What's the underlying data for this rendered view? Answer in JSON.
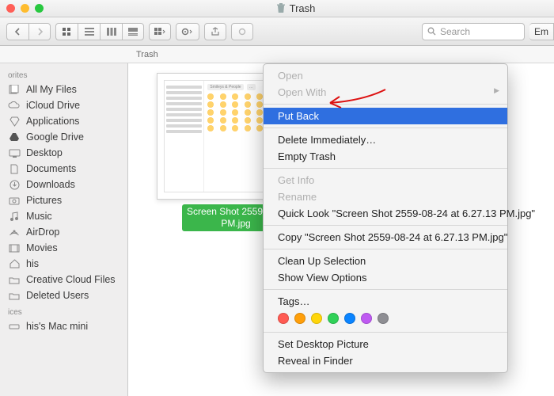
{
  "window": {
    "title": "Trash"
  },
  "toolbar": {
    "search_placeholder": "Search",
    "empty_label": "Em"
  },
  "location": {
    "label": "Trash"
  },
  "sidebar": {
    "sections": [
      {
        "head": "orites",
        "items": [
          {
            "label": "All My Files",
            "icon": "all-files"
          },
          {
            "label": "iCloud Drive",
            "icon": "cloud"
          },
          {
            "label": "Applications",
            "icon": "app"
          },
          {
            "label": "Google Drive",
            "icon": "gdrive"
          },
          {
            "label": "Desktop",
            "icon": "desktop"
          },
          {
            "label": "Documents",
            "icon": "documents"
          },
          {
            "label": "Downloads",
            "icon": "downloads"
          },
          {
            "label": "Pictures",
            "icon": "pictures"
          },
          {
            "label": "Music",
            "icon": "music"
          },
          {
            "label": "AirDrop",
            "icon": "airdrop"
          },
          {
            "label": "Movies",
            "icon": "movies"
          },
          {
            "label": "his",
            "icon": "home"
          },
          {
            "label": "Creative Cloud Files",
            "icon": "folder"
          },
          {
            "label": "Deleted Users",
            "icon": "folder"
          }
        ]
      },
      {
        "head": "ices",
        "items": [
          {
            "label": "his's Mac mini",
            "icon": "mac"
          }
        ]
      }
    ]
  },
  "file": {
    "name_line1": "Screen Shot 2559-08-2",
    "name_line2": "PM.jpg"
  },
  "context_menu": {
    "open": "Open",
    "open_with": "Open With",
    "put_back": "Put Back",
    "delete_immediately": "Delete Immediately…",
    "empty_trash": "Empty Trash",
    "get_info": "Get Info",
    "rename": "Rename",
    "quick_look": "Quick Look \"Screen Shot 2559-08-24 at 6.27.13 PM.jpg\"",
    "copy": "Copy \"Screen Shot 2559-08-24 at 6.27.13 PM.jpg\"",
    "clean_up": "Clean Up Selection",
    "show_view_options": "Show View Options",
    "tags": "Tags…",
    "tag_colors": [
      "#ff5a52",
      "#ff9f0a",
      "#ffd60a",
      "#30d158",
      "#0a84ff",
      "#bf5af2",
      "#8e8e93"
    ],
    "set_desktop": "Set Desktop Picture",
    "reveal": "Reveal in Finder"
  }
}
